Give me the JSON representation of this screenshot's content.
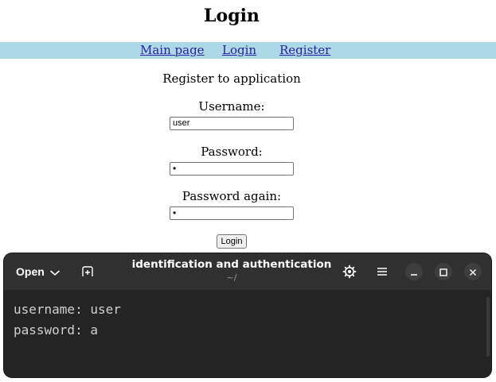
{
  "page": {
    "title": "Login",
    "nav": {
      "main": "Main page",
      "login": "Login",
      "register": "Register"
    },
    "form": {
      "heading": "Register to application",
      "username_label": "Username:",
      "username_value": "user",
      "password_label": "Password:",
      "password_value": "•",
      "password_again_label": "Password again:",
      "password_again_value": "•",
      "submit_label": "Login"
    }
  },
  "terminal": {
    "open_label": "Open",
    "title": "identification and authentication",
    "subtitle": "~/",
    "lines": [
      "username: user",
      "password: a"
    ]
  },
  "colors": {
    "nav_bar": "#add8e6",
    "link": "#2a1fa0",
    "terminal_bg": "#242424",
    "terminal_header": "#303030"
  },
  "icons": {
    "new_tab": "new-tab-icon",
    "settings": "gear-icon",
    "menu": "hamburger-menu-icon",
    "minimize": "minimize-icon",
    "maximize": "maximize-icon",
    "close": "close-icon"
  }
}
